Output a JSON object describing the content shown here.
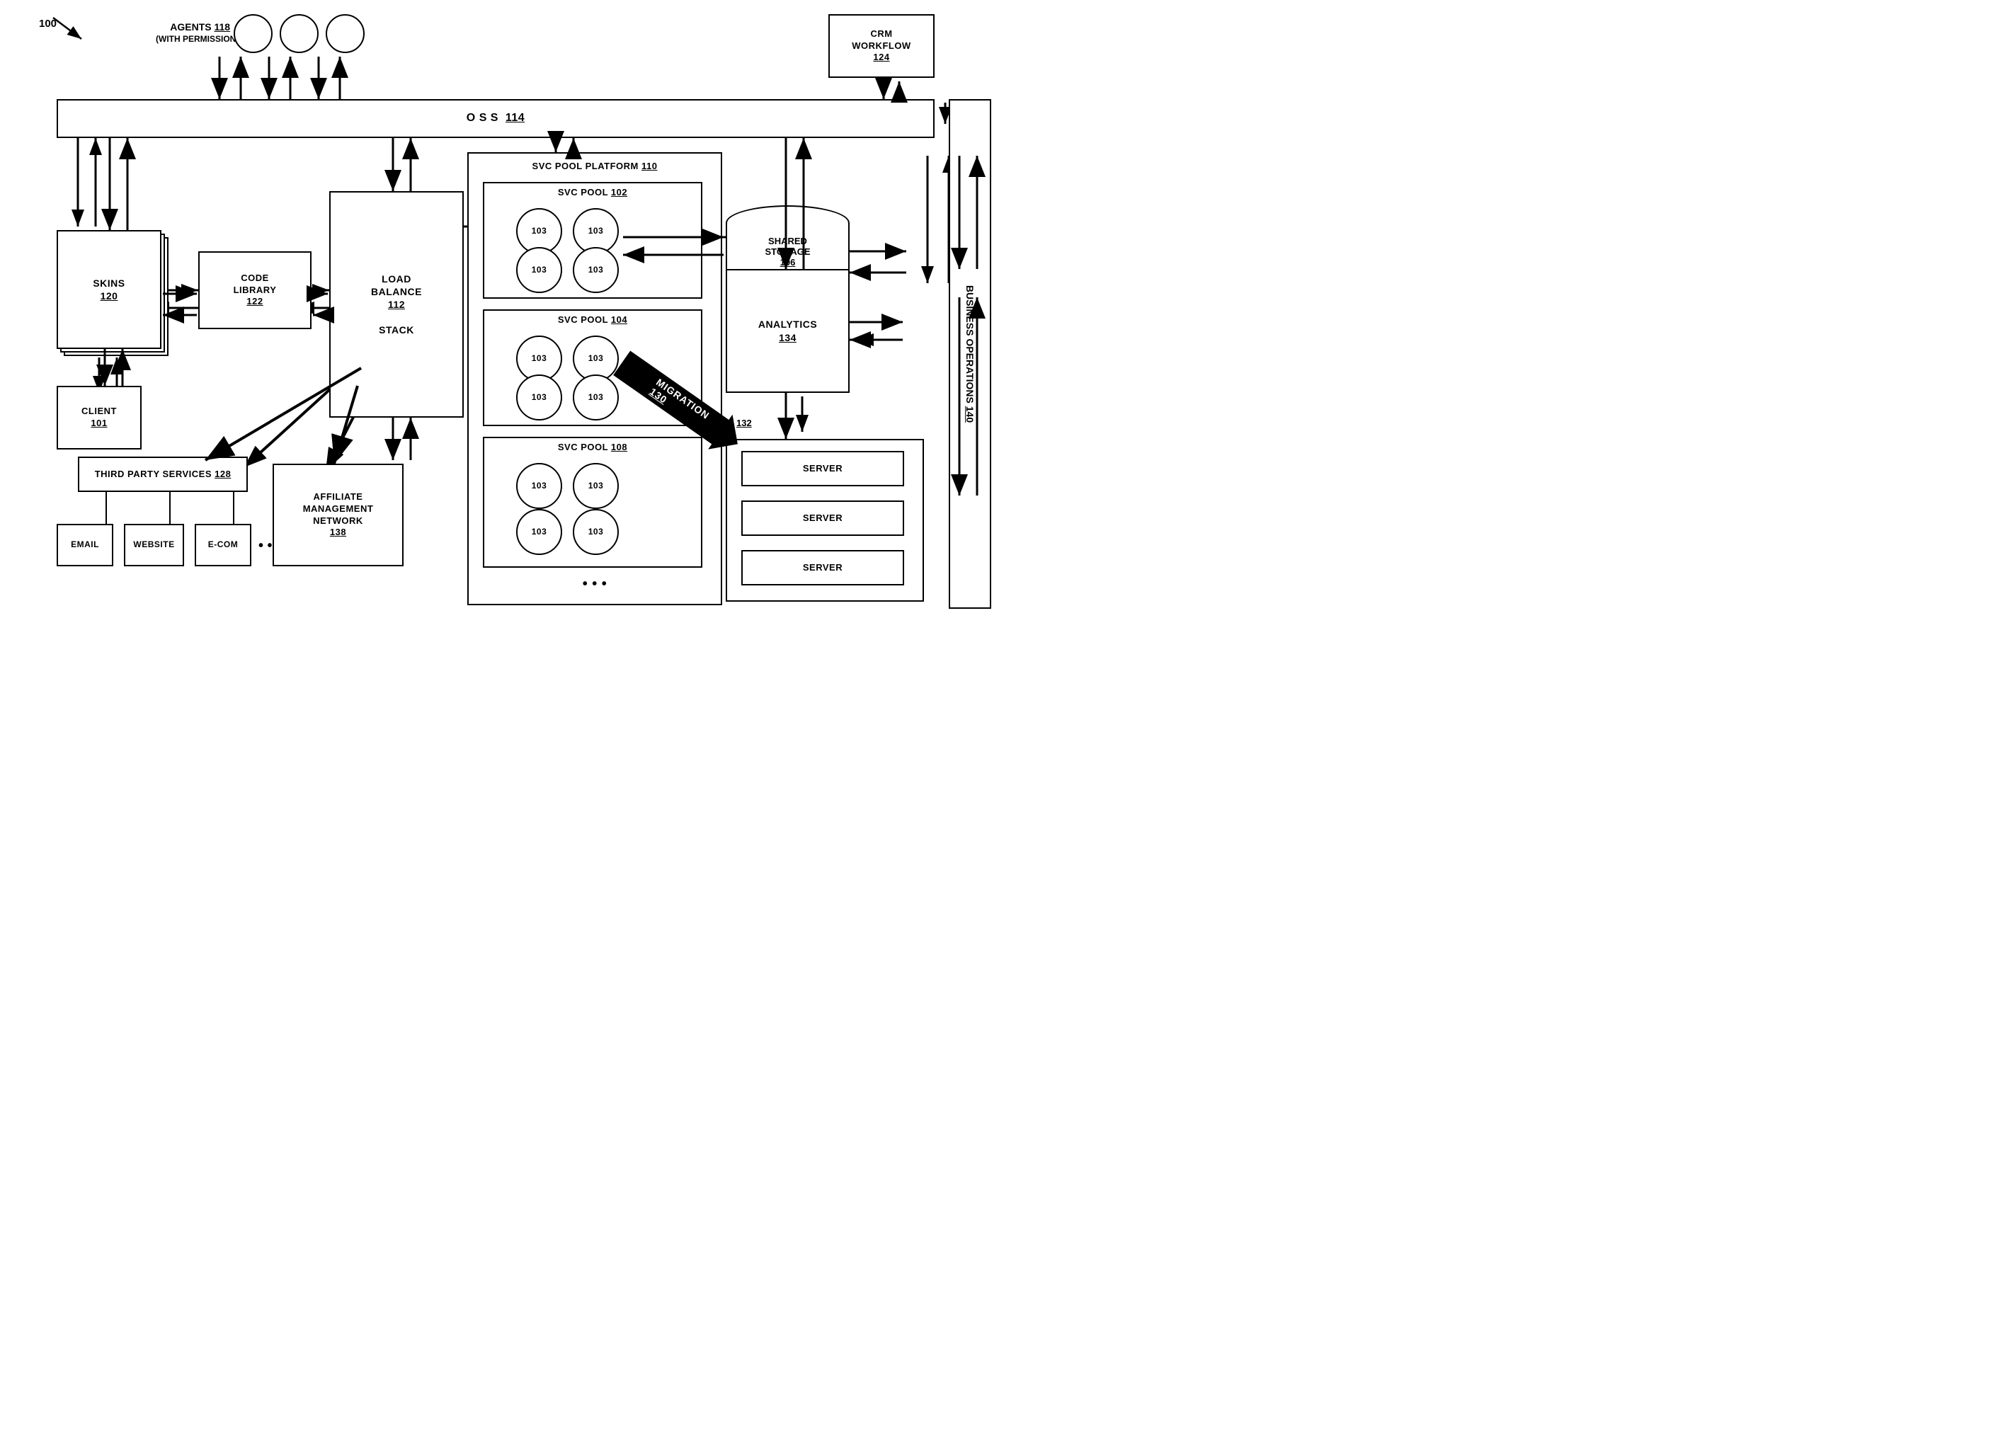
{
  "diagram": {
    "title": "100",
    "components": {
      "oss": {
        "label": "O S S",
        "ref": "114"
      },
      "agents": {
        "label": "AGENTS",
        "ref": "118",
        "sub": "(WITH PERMISSIONS)"
      },
      "crm": {
        "label": "CRM\nWORKFLOW",
        "ref": "124"
      },
      "svc_pool_platform": {
        "label": "SVC POOL PLATFORM",
        "ref": "110"
      },
      "svc_pool_102": {
        "label": "SVC POOL",
        "ref": "102"
      },
      "svc_pool_104": {
        "label": "SVC POOL",
        "ref": "104"
      },
      "svc_pool_108": {
        "label": "SVC POOL",
        "ref": "108"
      },
      "shared_storage": {
        "label": "SHARED\nSTORAGE",
        "ref": "106"
      },
      "analytics": {
        "label": "ANALYTICS",
        "ref": "134"
      },
      "load_balance": {
        "label": "LOAD\nBALANCE",
        "ref": "112",
        "sub": "STACK"
      },
      "code_library": {
        "label": "CODE\nLIBRARY",
        "ref": "122"
      },
      "skins": {
        "label": "SKINS",
        "ref": "120"
      },
      "client": {
        "label": "CLIENT",
        "ref": "101"
      },
      "third_party": {
        "label": "THIRD PARTY SERVICES",
        "ref": "128"
      },
      "affiliate": {
        "label": "AFFILIATE\nMANAGEMENT\nNETWORK",
        "ref": "138"
      },
      "server_group": {
        "ref": "132"
      },
      "server1": {
        "label": "SERVER"
      },
      "server2": {
        "label": "SERVER"
      },
      "server3": {
        "label": "SERVER"
      },
      "migration": {
        "label": "MIGRATION",
        "ref": "130"
      },
      "business_ops": {
        "label": "BUSINESS OPERATIONS",
        "ref": "140"
      },
      "email": {
        "label": "EMAIL"
      },
      "website": {
        "label": "WEBSITE"
      },
      "ecom": {
        "label": "E-COM"
      },
      "node103": {
        "label": "103"
      }
    }
  }
}
